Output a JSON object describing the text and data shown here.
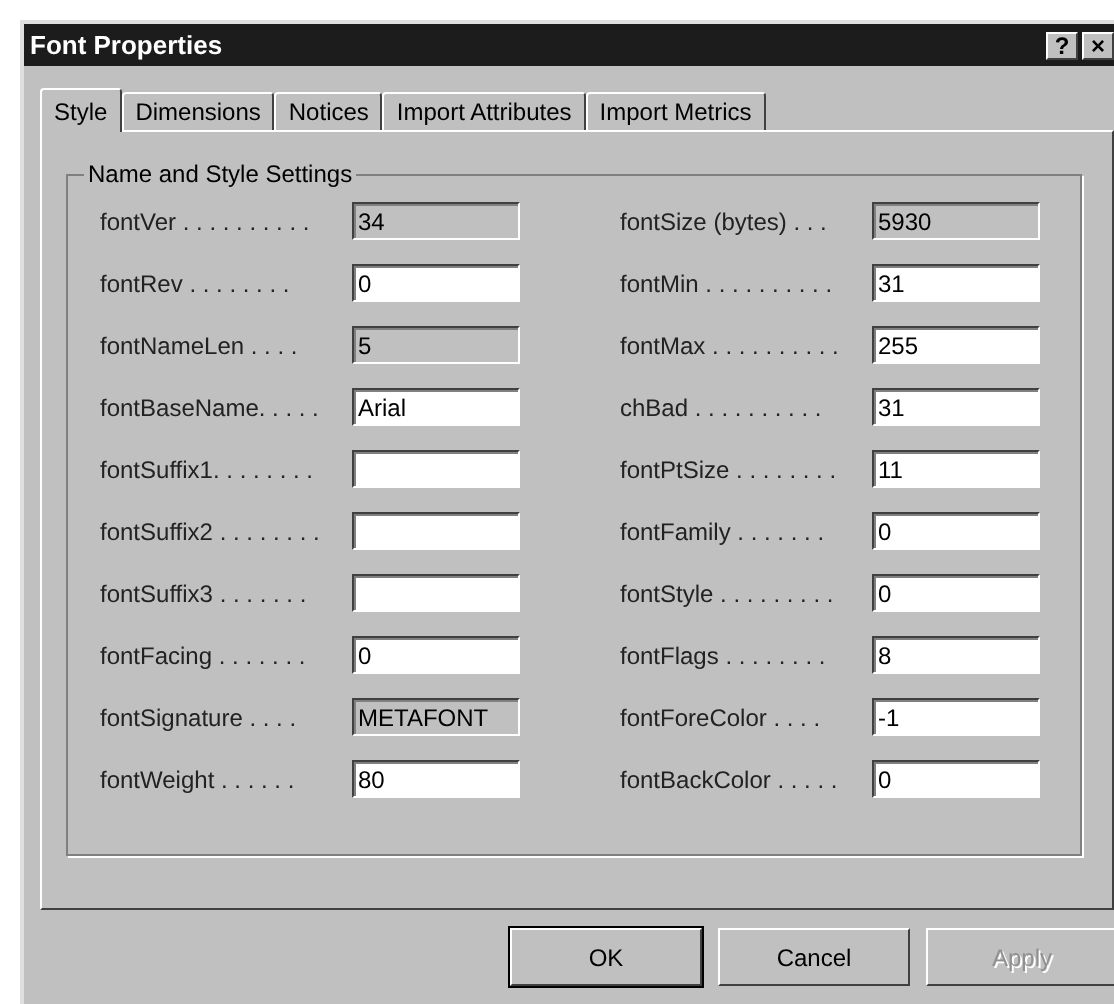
{
  "window": {
    "title": "Font Properties",
    "help_glyph": "?",
    "close_glyph": "×"
  },
  "tabs": [
    {
      "label": "Style",
      "selected": true
    },
    {
      "label": "Dimensions",
      "selected": false
    },
    {
      "label": "Notices",
      "selected": false
    },
    {
      "label": "Import Attributes",
      "selected": false
    },
    {
      "label": "Import Metrics",
      "selected": false
    }
  ],
  "group": {
    "title": "Name and Style Settings",
    "left_fields": [
      {
        "label": "fontVer . . . . . . . . . .",
        "value": "34",
        "disabled": true
      },
      {
        "label": "fontRev . . . . . . . .",
        "value": "0",
        "disabled": false
      },
      {
        "label": "fontNameLen . . . .",
        "value": "5",
        "disabled": true
      },
      {
        "label": "fontBaseName. . . . .",
        "value": "Arial",
        "disabled": false
      },
      {
        "label": "fontSuffix1. . . . . . . .",
        "disabled": false
      },
      {
        "label": "fontSuffix2 . . . . . . . .",
        "disabled": false
      },
      {
        "label": "fontSuffix3 . . . . . . .",
        "disabled": false
      },
      {
        "label": "fontFacing . . . . . . .",
        "value": "0",
        "disabled": false
      },
      {
        "label": "fontSignature . . . .",
        "value": "METAFONT",
        "disabled": true
      },
      {
        "label": "fontWeight . . . . . .",
        "value": "80",
        "disabled": false
      }
    ],
    "right_fields": [
      {
        "label": "fontSize (bytes) . . .",
        "value": "5930",
        "disabled": true
      },
      {
        "label": "fontMin . . . . . . . . . .",
        "value": "31",
        "disabled": false
      },
      {
        "label": "fontMax . . . . . . . . . .",
        "value": "255",
        "disabled": false
      },
      {
        "label": "chBad . . . . . . . . . .",
        "value": "31",
        "disabled": false
      },
      {
        "label": "fontPtSize . . . . . . . .",
        "value": "11",
        "disabled": false
      },
      {
        "label": "fontFamily . . . . . . .",
        "value": "0",
        "disabled": false
      },
      {
        "label": "fontStyle . . . . . . . . .",
        "value": "0",
        "disabled": false
      },
      {
        "label": "fontFlags . . . . . . . .",
        "value": "8",
        "disabled": false
      },
      {
        "label": "fontForeColor . . . .",
        "value": "-1",
        "disabled": false
      },
      {
        "label": "fontBackColor . . . . .",
        "value": "0",
        "disabled": false
      }
    ]
  },
  "buttons": [
    {
      "label": "OK",
      "disabled": false,
      "default": true
    },
    {
      "label": "Cancel",
      "disabled": false,
      "default": false
    },
    {
      "label": "Apply",
      "disabled": true,
      "default": false
    }
  ]
}
